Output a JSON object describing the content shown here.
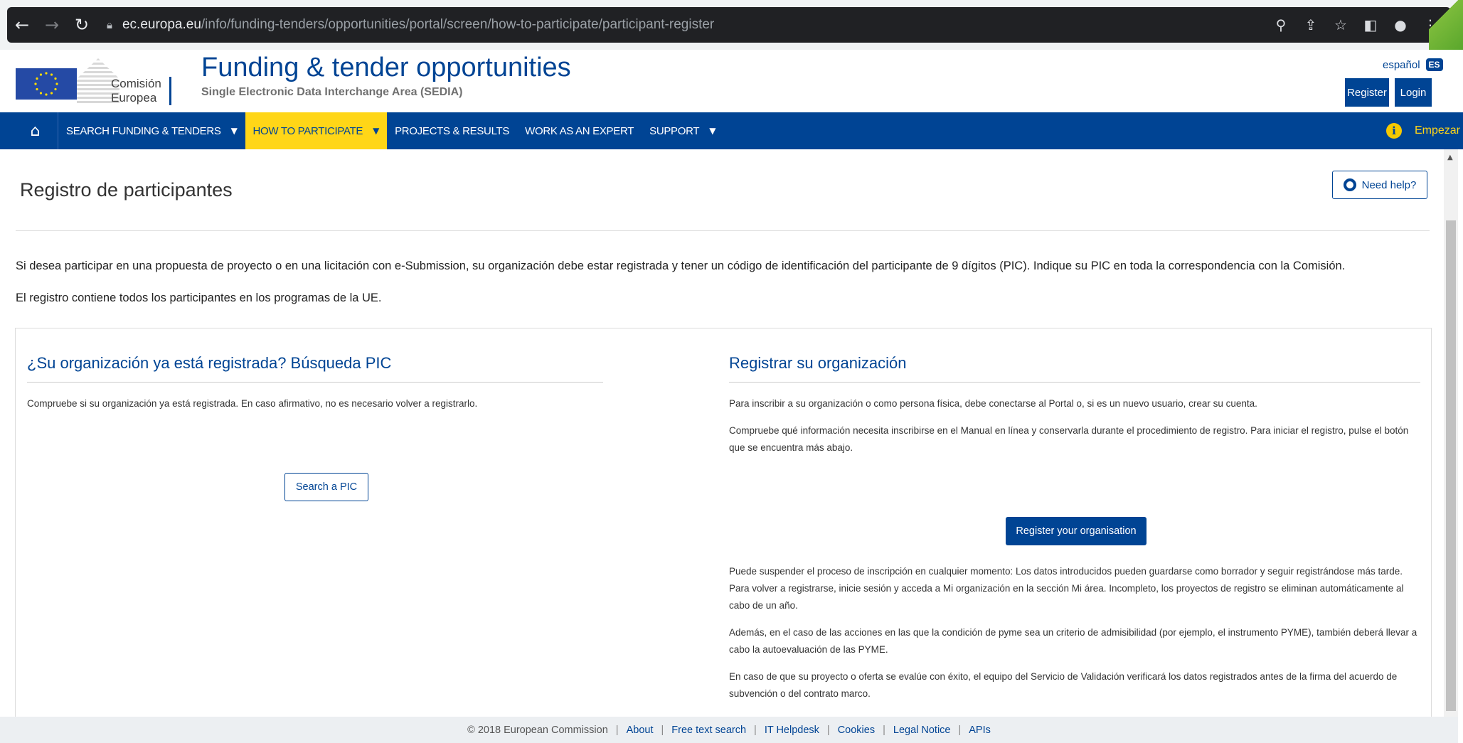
{
  "browser": {
    "url_host": "ec.europa.eu",
    "url_path": "/info/funding-tenders/opportunities/portal/screen/how-to-participate/participant-register"
  },
  "header": {
    "logo_line1": "Comisión",
    "logo_line2": "Europea",
    "title": "Funding & tender opportunities",
    "subtitle": "Single Electronic Data Interchange Area (SEDIA)",
    "language": "español",
    "language_code": "ES",
    "register": "Register",
    "login": "Login"
  },
  "nav": {
    "items": [
      {
        "label": "SEARCH FUNDING & TENDERS",
        "dropdown": true
      },
      {
        "label": "HOW TO PARTICIPATE",
        "dropdown": true,
        "active": true
      },
      {
        "label": "PROJECTS & RESULTS",
        "dropdown": false
      },
      {
        "label": "WORK AS AN EXPERT",
        "dropdown": false
      },
      {
        "label": "SUPPORT",
        "dropdown": true
      }
    ],
    "empezar": "Empezar"
  },
  "page": {
    "title": "Registro de participantes",
    "help": "Need help?",
    "intro1": "Si desea participar en una propuesta de proyecto o en una licitación con e-Submission, su organización debe estar registrada y tener un código de identificación del participante de 9 dígitos (PIC). Indique su PIC en toda la correspondencia con la Comisión.",
    "intro2": "El registro contiene todos los participantes en los programas de la UE."
  },
  "left": {
    "heading": "¿Su organización ya está registrada? Búsqueda PIC",
    "text": "Compruebe si su organización ya está registrada. En caso afirmativo, no es necesario volver a registrarlo.",
    "button": "Search a PIC"
  },
  "right": {
    "heading": "Registrar su organización",
    "p1": "Para inscribir a su organización o como persona física, debe conectarse al Portal o, si es un nuevo usuario, crear su cuenta.",
    "p2": "Compruebe qué información necesita inscribirse en el Manual en línea y conservarla durante el procedimiento de registro. Para iniciar el registro, pulse el botón que se encuentra más abajo.",
    "button": "Register your organisation",
    "p3": "Puede suspender el proceso de inscripción en cualquier momento: Los datos introducidos pueden guardarse como borrador y seguir registrándose más tarde. Para volver a registrarse, inicie sesión y acceda a Mi organización en la sección Mi área. Incompleto, los proyectos de registro se eliminan automáticamente al cabo de un año.",
    "p4": "Además, en el caso de las acciones en las que la condición de pyme sea un criterio de admisibilidad (por ejemplo, el instrumento PYME), también deberá llevar a cabo la autoevaluación de las PYME.",
    "p5": "En caso de que su proyecto o oferta se evalúe con éxito, el equipo del Servicio de Validación verificará los datos registrados antes de la firma del acuerdo de subvención o del contrato marco."
  },
  "footer": {
    "copyright": "© 2018 European Commission",
    "links": [
      "About",
      "Free text search",
      "IT Helpdesk",
      "Cookies",
      "Legal Notice",
      "APIs"
    ]
  }
}
